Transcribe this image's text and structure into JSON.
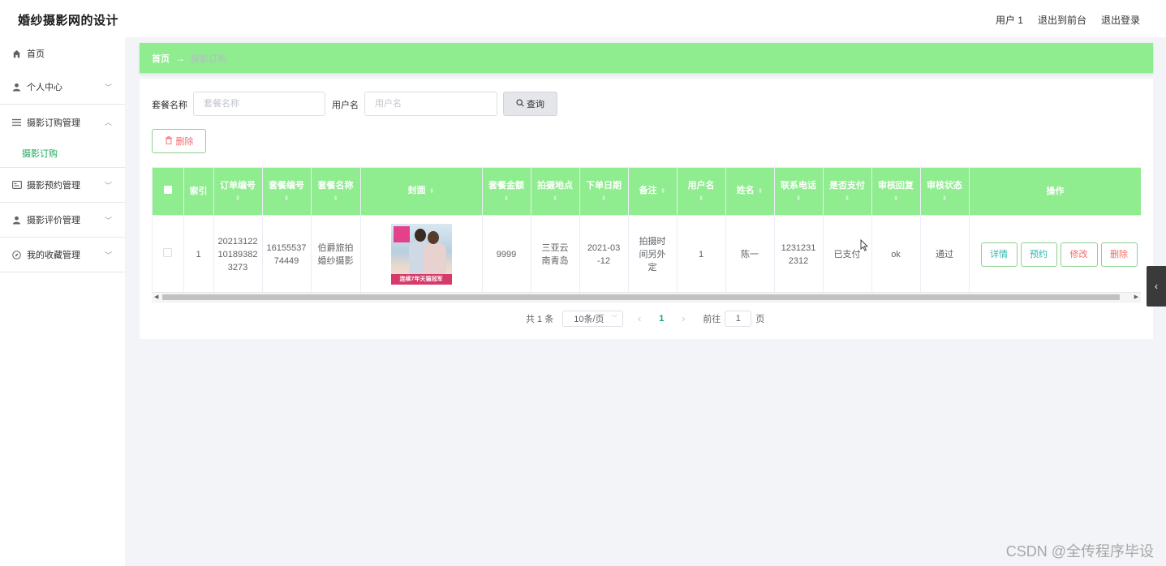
{
  "header": {
    "title": "婚纱摄影网的设计",
    "user": "用户 1",
    "to_front": "退出到前台",
    "logout": "退出登录"
  },
  "sidebar": {
    "items": [
      {
        "label": "首页",
        "icon": "home-icon"
      },
      {
        "label": "个人中心",
        "icon": "user-icon"
      },
      {
        "label": "摄影订购管理",
        "icon": "menu-icon",
        "children": [
          {
            "label": "摄影订购"
          }
        ]
      },
      {
        "label": "摄影预约管理",
        "icon": "card-icon"
      },
      {
        "label": "摄影评价管理",
        "icon": "user-icon"
      },
      {
        "label": "我的收藏管理",
        "icon": "compass-icon"
      }
    ]
  },
  "breadcrumb": {
    "home": "首页",
    "separator": "→",
    "current": "摄影订购"
  },
  "search": {
    "package_label": "套餐名称",
    "package_placeholder": "套餐名称",
    "user_label": "用户名",
    "user_placeholder": "用户名",
    "query_label": "查询"
  },
  "actions": {
    "delete_label": "删除"
  },
  "table": {
    "headers": [
      "索引",
      "订单编号",
      "套餐编号",
      "套餐名称",
      "封面",
      "套餐金额",
      "拍摄地点",
      "下单日期",
      "备注",
      "用户名",
      "姓名",
      "联系电话",
      "是否支付",
      "审核回复",
      "审核状态",
      "操作"
    ],
    "rows": [
      {
        "index": "1",
        "order_no": "20213122101893823273",
        "package_no": "1615553774449",
        "package_name": "伯爵旅拍婚纱摄影",
        "cover_text": "连续7年天猫冠军",
        "amount": "9999",
        "location": "三亚云南青岛",
        "order_date": "2021-03-12",
        "remark": "拍摄时间另外定",
        "username": "1",
        "name": "陈一",
        "phone": "12312312312",
        "paid": "已支付",
        "reply": "ok",
        "status": "通过"
      }
    ],
    "row_actions": {
      "detail": "详情",
      "book": "预约",
      "edit": "修改",
      "delete": "删除"
    }
  },
  "pagination": {
    "total": "共 1 条",
    "page_size": "10条/页",
    "current_page": "1",
    "goto_label": "前往",
    "goto_value": "1",
    "page_unit": "页"
  },
  "watermark": "CSDN @全传程序毕设",
  "colors": {
    "accent": "#8fec8f",
    "link": "#17a85b",
    "danger": "#f56c6c",
    "info": "#2db7b0"
  }
}
